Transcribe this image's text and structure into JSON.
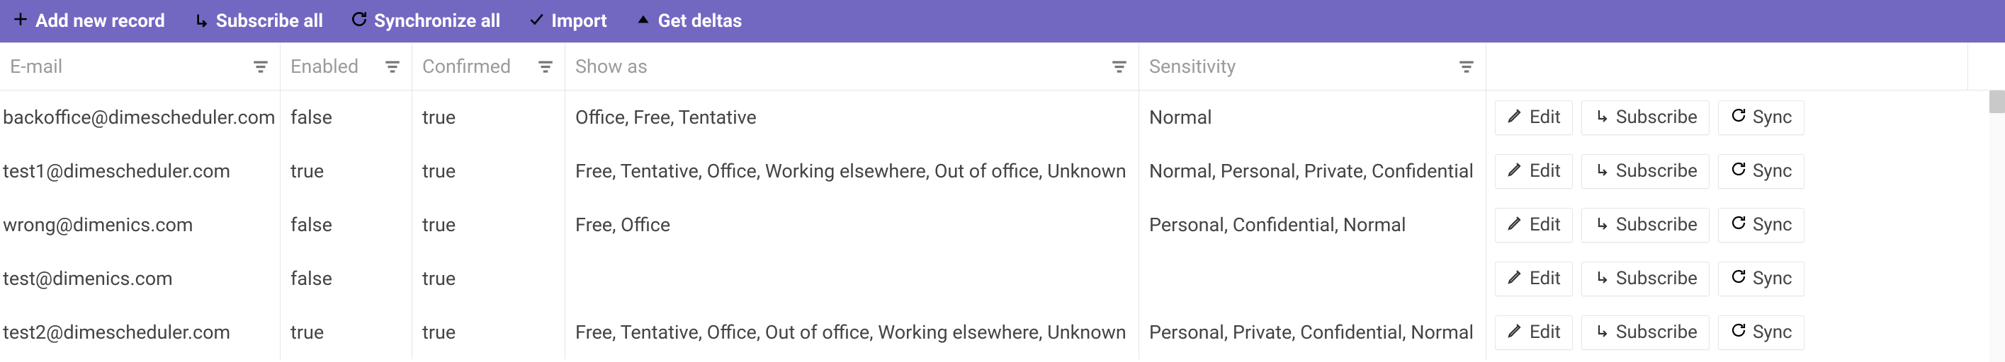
{
  "toolbar": {
    "add_label": "Add new record",
    "subscribe_all_label": "Subscribe all",
    "synchronize_all_label": "Synchronize all",
    "import_label": "Import",
    "get_deltas_label": "Get deltas"
  },
  "columns": {
    "email": "E-mail",
    "enabled": "Enabled",
    "confirmed": "Confirmed",
    "showas": "Show as",
    "sensitivity": "Sensitivity"
  },
  "actions": {
    "edit": "Edit",
    "subscribe": "Subscribe",
    "sync": "Sync"
  },
  "rows": [
    {
      "email": "backoffice@dimescheduler.com",
      "enabled": "false",
      "confirmed": "true",
      "showas": "Office, Free, Tentative",
      "sensitivity": "Normal"
    },
    {
      "email": "test1@dimescheduler.com",
      "enabled": "true",
      "confirmed": "true",
      "showas": "Free, Tentative, Office, Working elsewhere, Out of office, Unknown",
      "sensitivity": "Normal, Personal, Private, Confidential"
    },
    {
      "email": "wrong@dimenics.com",
      "enabled": "false",
      "confirmed": "true",
      "showas": "Free, Office",
      "sensitivity": "Personal, Confidential, Normal"
    },
    {
      "email": "test@dimenics.com",
      "enabled": "false",
      "confirmed": "true",
      "showas": "",
      "sensitivity": ""
    },
    {
      "email": "test2@dimescheduler.com",
      "enabled": "true",
      "confirmed": "true",
      "showas": "Free, Tentative, Office, Out of office, Working elsewhere, Unknown",
      "sensitivity": "Personal, Private, Confidential, Normal"
    }
  ]
}
